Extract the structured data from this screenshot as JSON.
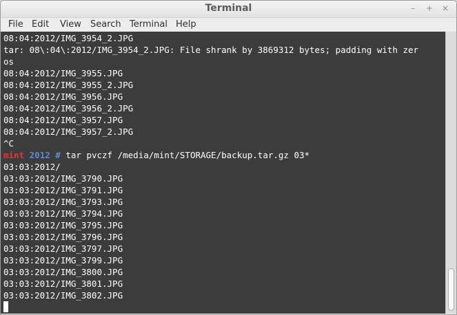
{
  "window": {
    "title": "Terminal",
    "controls": {
      "minimize": "–",
      "maximize": "+",
      "close": "×"
    }
  },
  "menu": [
    "File",
    "Edit",
    "View",
    "Search",
    "Terminal",
    "Help"
  ],
  "terminal": {
    "lines_before": [
      "08:04:2012/IMG_3954_2.JPG",
      "tar: 08\\:04\\:2012/IMG_3954_2.JPG: File shrank by 3869312 bytes; padding with zer",
      "os",
      "08:04:2012/IMG_3955.JPG",
      "08:04:2012/IMG_3955_2.JPG",
      "08:04:2012/IMG_3956.JPG",
      "08:04:2012/IMG_3956_2.JPG",
      "08:04:2012/IMG_3957.JPG",
      "08:04:2012/IMG_3957_2.JPG",
      "^C"
    ],
    "prompt": {
      "user": "mint",
      "dir": "2012",
      "symbol": "#",
      "command": "tar pvczf /media/mint/STORAGE/backup.tar.gz 03*"
    },
    "lines_after": [
      "03:03:2012/",
      "03:03:2012/IMG_3790.JPG",
      "03:03:2012/IMG_3791.JPG",
      "03:03:2012/IMG_3793.JPG",
      "03:03:2012/IMG_3794.JPG",
      "03:03:2012/IMG_3795.JPG",
      "03:03:2012/IMG_3796.JPG",
      "03:03:2012/IMG_3797.JPG",
      "03:03:2012/IMG_3799.JPG",
      "03:03:2012/IMG_3800.JPG",
      "03:03:2012/IMG_3801.JPG",
      "03:03:2012/IMG_3802.JPG"
    ]
  }
}
